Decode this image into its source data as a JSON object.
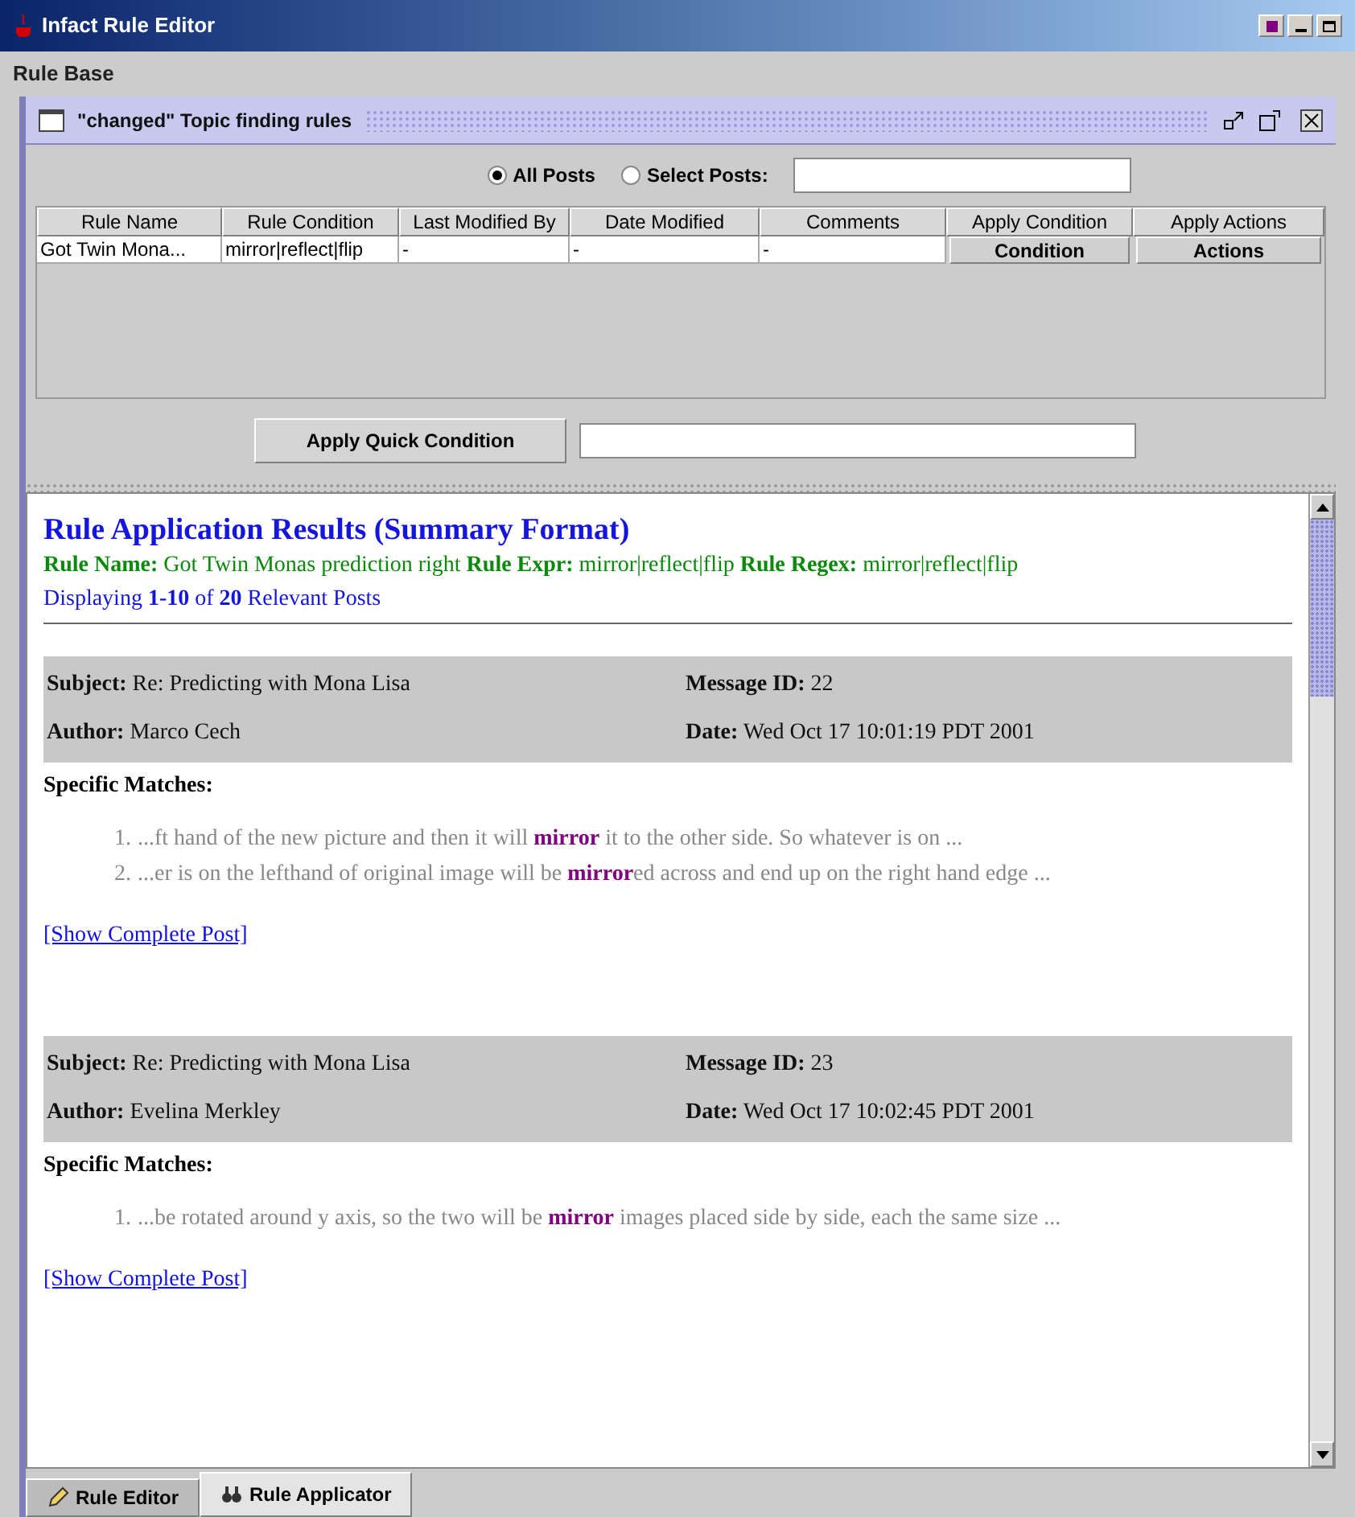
{
  "window": {
    "title": "Infact Rule Editor"
  },
  "menu": [
    "Rule Base"
  ],
  "frame": {
    "title": "\"changed\" Topic finding rules"
  },
  "filter": {
    "options": [
      {
        "label": "All Posts",
        "selected": true
      },
      {
        "label": "Select Posts:",
        "selected": false
      }
    ]
  },
  "table": {
    "columns": [
      "Rule Name",
      "Rule Condition",
      "Last Modified By",
      "Date Modified",
      "Comments",
      "Apply Condition",
      "Apply Actions"
    ],
    "rows": [
      {
        "cells": [
          {
            "kind": "text",
            "text": "Got Twin Mona..."
          },
          {
            "kind": "text",
            "text": "mirror|reflect|flip"
          },
          {
            "kind": "text",
            "text": "-"
          },
          {
            "kind": "text",
            "text": "-"
          },
          {
            "kind": "text",
            "text": "-"
          },
          {
            "kind": "button",
            "text": "Condition"
          },
          {
            "kind": "button",
            "text": "Actions"
          }
        ]
      }
    ]
  },
  "quick": {
    "button": "Apply Quick Condition"
  },
  "results": {
    "title": "Rule Application Results (Summary Format)",
    "info": [
      {
        "label": "Rule Name:",
        "value": "Got Twin Monas prediction right"
      },
      {
        "label": "Rule Expr:",
        "value": "mirror|reflect|flip"
      },
      {
        "label": "Rule Regex:",
        "value": "mirror|reflect|flip"
      }
    ],
    "count": "Displaying **1-10** of **20** Relevant Posts",
    "posts": [
      {
        "subject_label": "Subject:",
        "subject": "Re: Predicting with Mona Lisa",
        "id_label": "Message ID:",
        "id": "22",
        "author_label": "Author:",
        "author": "Marco Cech",
        "date_label": "Date:",
        "date": "Wed Oct 17 10:01:19 PDT 2001",
        "matches_label": "Specific Matches:",
        "matches": [
          {
            "number": "1.",
            "text": "...ft hand of the new picture and then it will **mirror** it to the other side. So whatever is on ..."
          },
          {
            "number": "2.",
            "text": "...er is on the lefthand of original image will be **mirror**ed across and end up on the right hand edge ..."
          }
        ],
        "link": "[Show Complete Post]"
      },
      {
        "subject_label": "Subject:",
        "subject": "Re: Predicting with Mona Lisa",
        "id_label": "Message ID:",
        "id": "23",
        "author_label": "Author:",
        "author": "Evelina Merkley",
        "date_label": "Date:",
        "date": "Wed Oct 17 10:02:45 PDT 2001",
        "matches_label": "Specific Matches:",
        "matches": [
          {
            "number": "1.",
            "text": "...be rotated around y axis, so the two will be **mirror** images placed side by side, each the same size ..."
          }
        ],
        "link": "[Show Complete Post]"
      }
    ]
  },
  "tabs": [
    {
      "label": "Rule Editor",
      "selected": false
    },
    {
      "label": "Rule Applicator",
      "selected": true
    }
  ]
}
